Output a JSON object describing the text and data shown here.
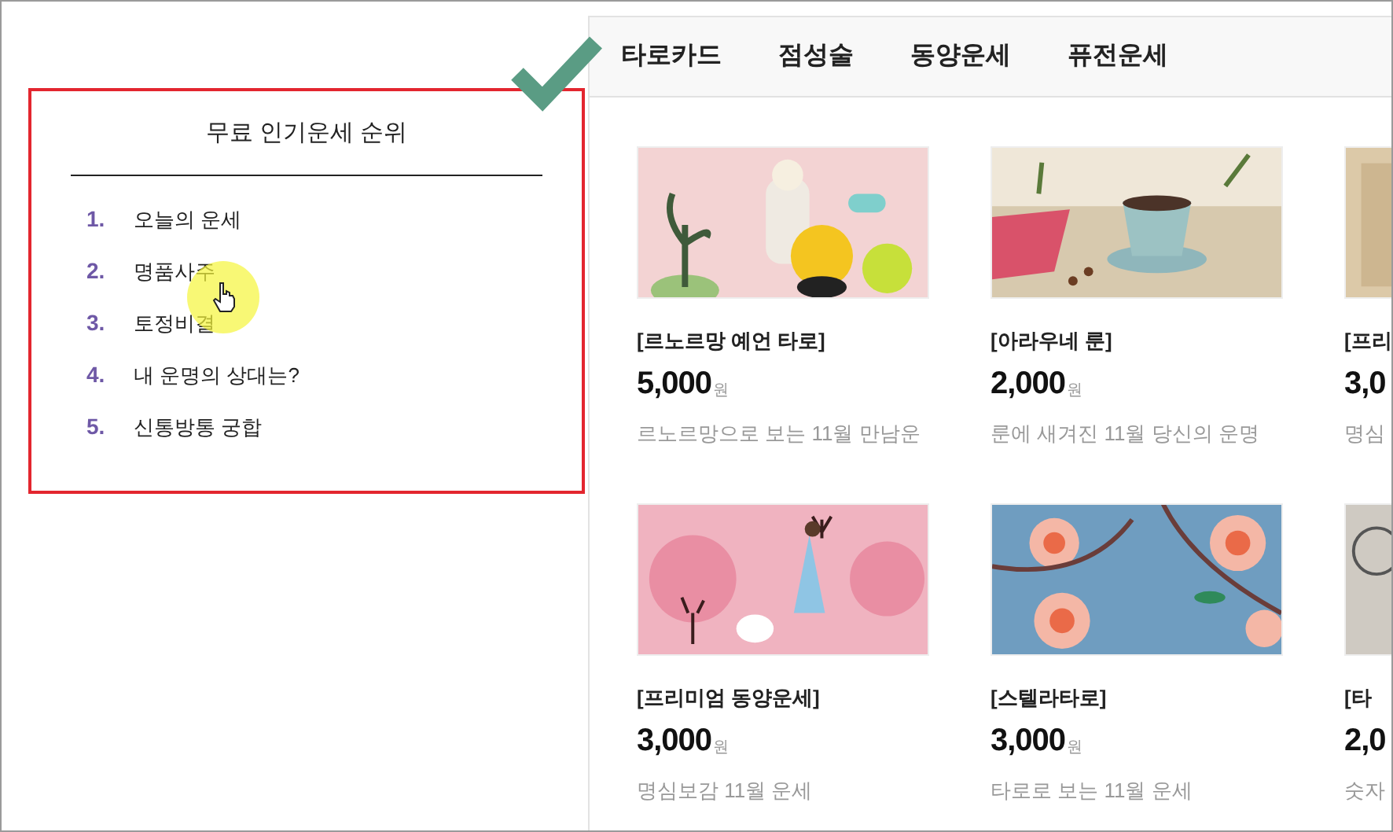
{
  "ranking": {
    "title": "무료 인기운세 순위",
    "items": [
      {
        "rank": "1.",
        "label": "오늘의 운세"
      },
      {
        "rank": "2.",
        "label": "명품사주"
      },
      {
        "rank": "3.",
        "label": "토정비결"
      },
      {
        "rank": "4.",
        "label": "내 운명의 상대는?"
      },
      {
        "rank": "5.",
        "label": "신통방통 궁합"
      }
    ]
  },
  "tabs": [
    "타로카드",
    "점성술",
    "동양운세",
    "퓨전운세"
  ],
  "products": [
    {
      "title": "[르노르망 예언 타로]",
      "price": "5,000",
      "unit": "원",
      "description": "르노르망으로 보는 11월 만남운"
    },
    {
      "title": "[아라우네 룬]",
      "price": "2,000",
      "unit": "원",
      "description": "룬에 새겨진 11월 당신의 운명"
    },
    {
      "title": "[프리",
      "price": "3,0",
      "description": "명심"
    },
    {
      "title": "[프리미엄 동양운세]",
      "price": "3,000",
      "unit": "원",
      "description": "명심보감 11월 운세"
    },
    {
      "title": "[스텔라타로]",
      "price": "3,000",
      "unit": "원",
      "description": "타로로 보는 11월 운세"
    },
    {
      "title": "[타",
      "price": "2,0",
      "description": "숫자"
    }
  ]
}
